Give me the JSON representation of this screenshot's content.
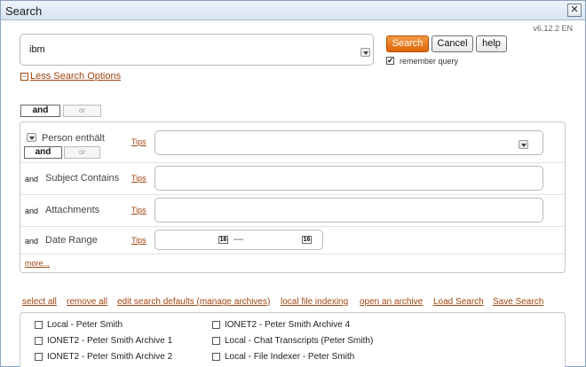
{
  "window": {
    "title": "Search"
  },
  "version": "v6.12.2  EN",
  "query": {
    "value": "ibm"
  },
  "buttons": {
    "search": "Search",
    "cancel": "Cancel",
    "help": "help"
  },
  "remember_query": {
    "label": "remember query",
    "checked": "✔"
  },
  "options_toggle": {
    "label": "Less Search Options",
    "icon": "−"
  },
  "global_op": {
    "and": "and",
    "or": "or"
  },
  "criteria": [
    {
      "op_and": "and",
      "op_or": "or",
      "label": "Person enthält",
      "tips": "Tips"
    },
    {
      "op": "and",
      "label": "Subject Contains",
      "tips": "Tips"
    },
    {
      "op": "and",
      "label": "Attachments",
      "tips": "Tips"
    },
    {
      "op": "and",
      "label": "Date Range",
      "tips": "Tips",
      "cal_from": "16",
      "cal_to": "16",
      "dash": "—"
    }
  ],
  "more_link": "more...",
  "footer_links": {
    "select_all": "select all",
    "remove_all": "remove all",
    "edit_defaults": "edit search defaults (manage archives)",
    "local_indexing": "local file indexing",
    "open_archive": "open an archive",
    "load_search": "Load Search",
    "save_search": "Save Search"
  },
  "archives": [
    "Local - Peter Smith",
    "IONET2 - Peter Smith Archive 4",
    "IONET2 - Peter Smith Archive 1",
    "Local - Chat Transcripts (Peter Smith)",
    "IONET2 - Peter Smith Archive 2",
    "Local - File Indexer - Peter Smith"
  ]
}
